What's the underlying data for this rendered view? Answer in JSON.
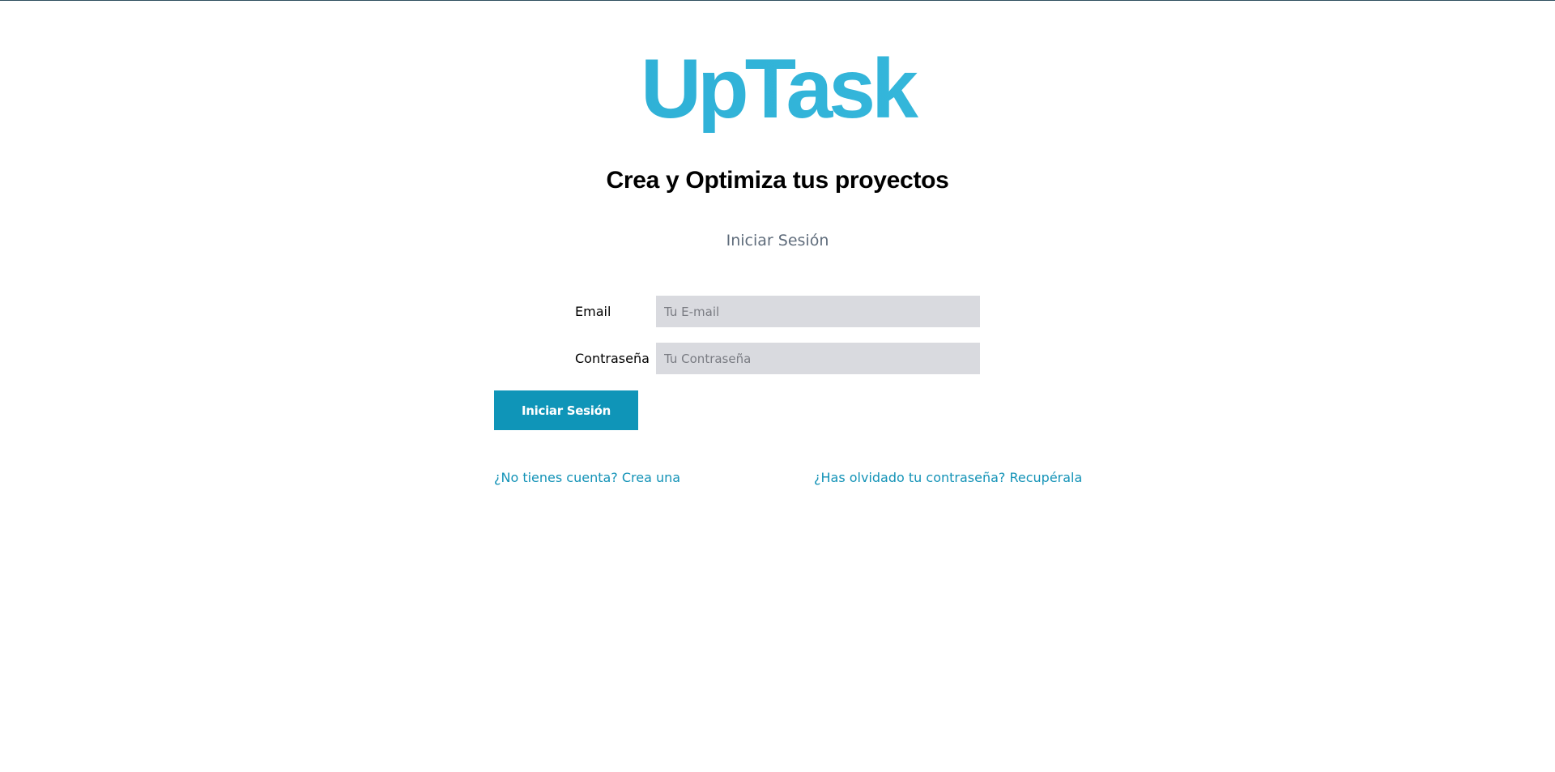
{
  "brand": {
    "name": "UpTask",
    "accent_color": "#2ab0d6",
    "button_color": "#0f95b8",
    "link_color": "#1493b7"
  },
  "header": {
    "tagline": "Crea y Optimiza tus proyectos"
  },
  "login": {
    "title": "Iniciar Sesión",
    "email": {
      "label": "Email",
      "placeholder": "Tu E-mail",
      "value": ""
    },
    "password": {
      "label": "Contraseña",
      "placeholder": "Tu Contraseña",
      "value": ""
    },
    "submit_label": "Iniciar Sesión"
  },
  "links": {
    "register": "¿No tienes cuenta? Crea una",
    "forgot_password": "¿Has olvidado tu contraseña? Recupérala"
  }
}
